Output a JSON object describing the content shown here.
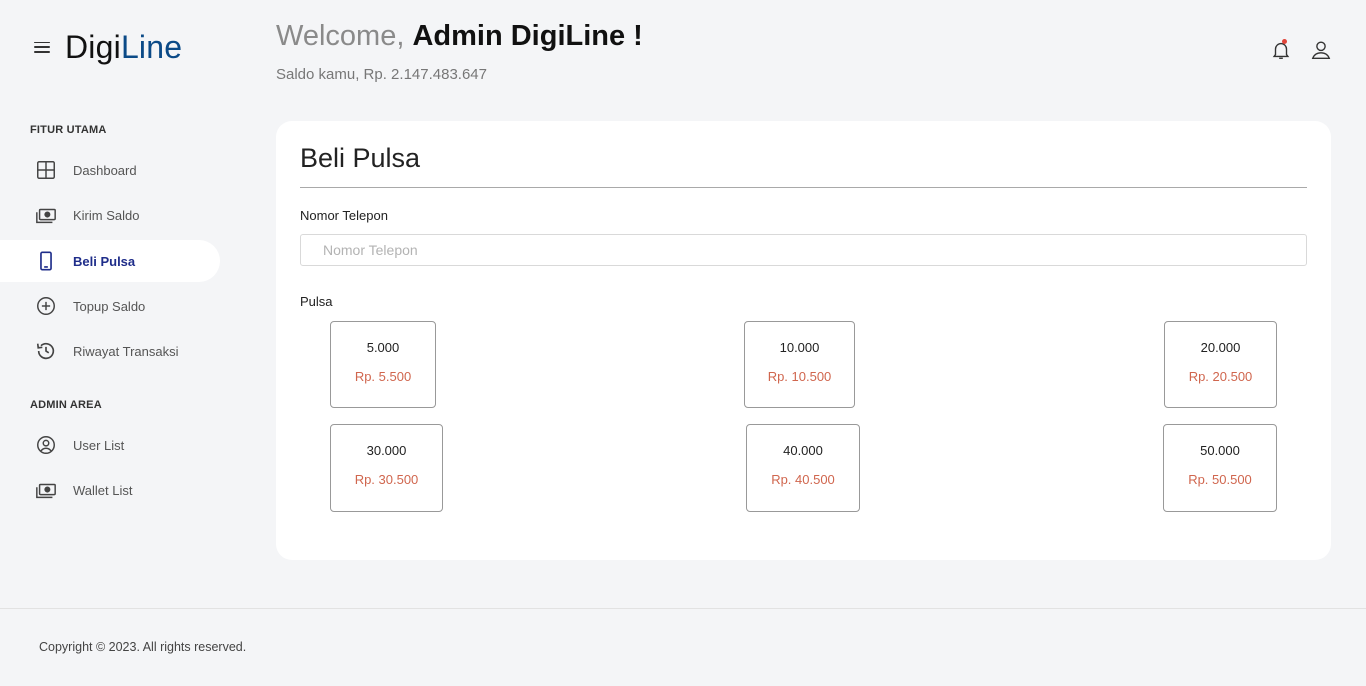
{
  "brand": {
    "logo_part1": "Digi",
    "logo_part2": "Line"
  },
  "sidebar": {
    "section_main": "FITUR UTAMA",
    "section_admin": "ADMIN AREA",
    "items": [
      {
        "label": "Dashboard",
        "icon": "grid-icon"
      },
      {
        "label": "Kirim Saldo",
        "icon": "money-icon"
      },
      {
        "label": "Beli Pulsa",
        "icon": "phone-icon",
        "active": true
      },
      {
        "label": "Topup Saldo",
        "icon": "plus-circle-icon"
      },
      {
        "label": "Riwayat Transaksi",
        "icon": "history-icon"
      },
      {
        "label": "User List",
        "icon": "user-circle-icon"
      },
      {
        "label": "Wallet List",
        "icon": "money-icon"
      }
    ]
  },
  "header": {
    "welcome_prefix": "Welcome, ",
    "welcome_name": "Admin DigiLine !",
    "saldo": "Saldo kamu, Rp. 2.147.483.647"
  },
  "card": {
    "title": "Beli Pulsa",
    "phone_label": "Nomor Telepon",
    "phone_placeholder": "Nomor Telepon",
    "phone_value": "",
    "pulsa_label": "Pulsa",
    "options": [
      {
        "amount": "5.000",
        "price": "Rp. 5.500"
      },
      {
        "amount": "10.000",
        "price": "Rp. 10.500"
      },
      {
        "amount": "20.000",
        "price": "Rp. 20.500"
      },
      {
        "amount": "30.000",
        "price": "Rp. 30.500"
      },
      {
        "amount": "40.000",
        "price": "Rp. 40.500"
      },
      {
        "amount": "50.000",
        "price": "Rp. 50.500"
      }
    ]
  },
  "footer": {
    "copyright": "Copyright © 2023. All rights reserved."
  },
  "colors": {
    "accent": "#1f2d8a",
    "logo_blue": "#0b4a87",
    "price": "#d0664e",
    "background": "#f4f5f7"
  }
}
